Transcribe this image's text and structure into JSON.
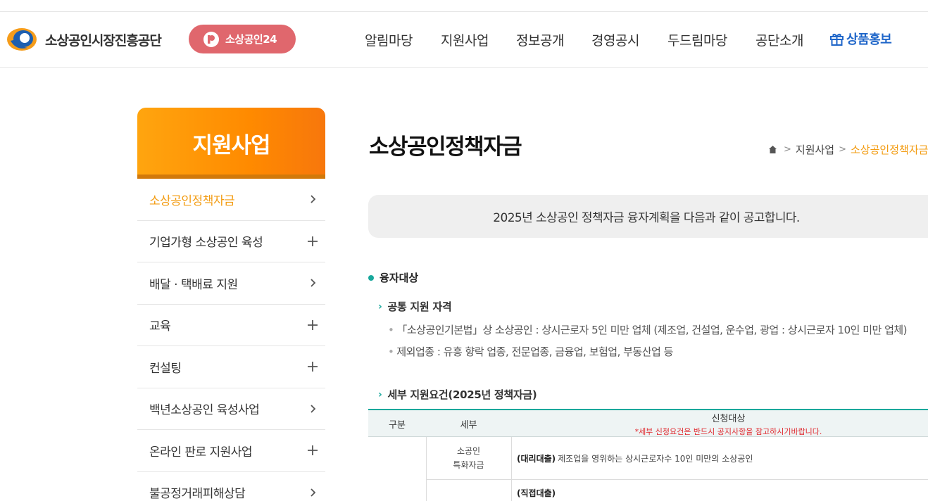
{
  "header": {
    "logo_text": "소상공인시장진흥공단",
    "pill_label": "소상공인24",
    "nav": [
      "알림마당",
      "지원사업",
      "정보공개",
      "경영공시",
      "두드림마당",
      "공단소개"
    ],
    "promo_label": "상품홍보"
  },
  "sidebar": {
    "title": "지원사업",
    "items": [
      {
        "label": "소상공인정책자금",
        "symbol": "chevron"
      },
      {
        "label": "기업가형 소상공인 육성",
        "symbol": "plus"
      },
      {
        "label": "배달 · 택배료 지원",
        "symbol": "chevron"
      },
      {
        "label": "교육",
        "symbol": "plus"
      },
      {
        "label": "컨설팅",
        "symbol": "plus"
      },
      {
        "label": "백년소상공인 육성사업",
        "symbol": "chevron"
      },
      {
        "label": "온라인 판로 지원사업",
        "symbol": "plus"
      },
      {
        "label": "불공정거래피해상담",
        "symbol": "chevron"
      }
    ]
  },
  "main": {
    "title": "소상공인정책자금",
    "breadcrumb": [
      "지원사업",
      "소상공인정책자금"
    ],
    "notice": "2025년 소상공인 정책자금 융자계획을 다음과 같이 공고합니다.",
    "section_title": "융자대상",
    "sub1_title": "공통 지원 자격",
    "bullets": [
      "「소상공인기본법」상 소상공인 : 상시근로자 5인 미만 업체 (제조업, 건설업, 운수업, 광업 : 상시근로자 10인 미만 업체)",
      "제외업종 : 유흥 향락 업종, 전문업종, 금융업, 보험업, 부동산업 등"
    ],
    "sub2_title": "세부 지원요건(2025년 정책자금)",
    "table": {
      "col1": "구분",
      "col2": "세부",
      "col3": "신청대상",
      "col3_note": "*세부 신청요건은 반드시 공지사항을 참고하시기바랍니다.",
      "row1_detail_1": "소공인",
      "row1_detail_2": "특화자금",
      "row1_tag": "(대리대출)",
      "row1_text": "제조업을 영위하는 상시근로자수 10인 미만의 소상공인",
      "row2_tag": "(직접대출)"
    }
  },
  "colors": {
    "accent_orange": "#f39c12",
    "pill_red": "#e0676d",
    "teal": "#19a89c",
    "promo_blue": "#1f66c9"
  }
}
